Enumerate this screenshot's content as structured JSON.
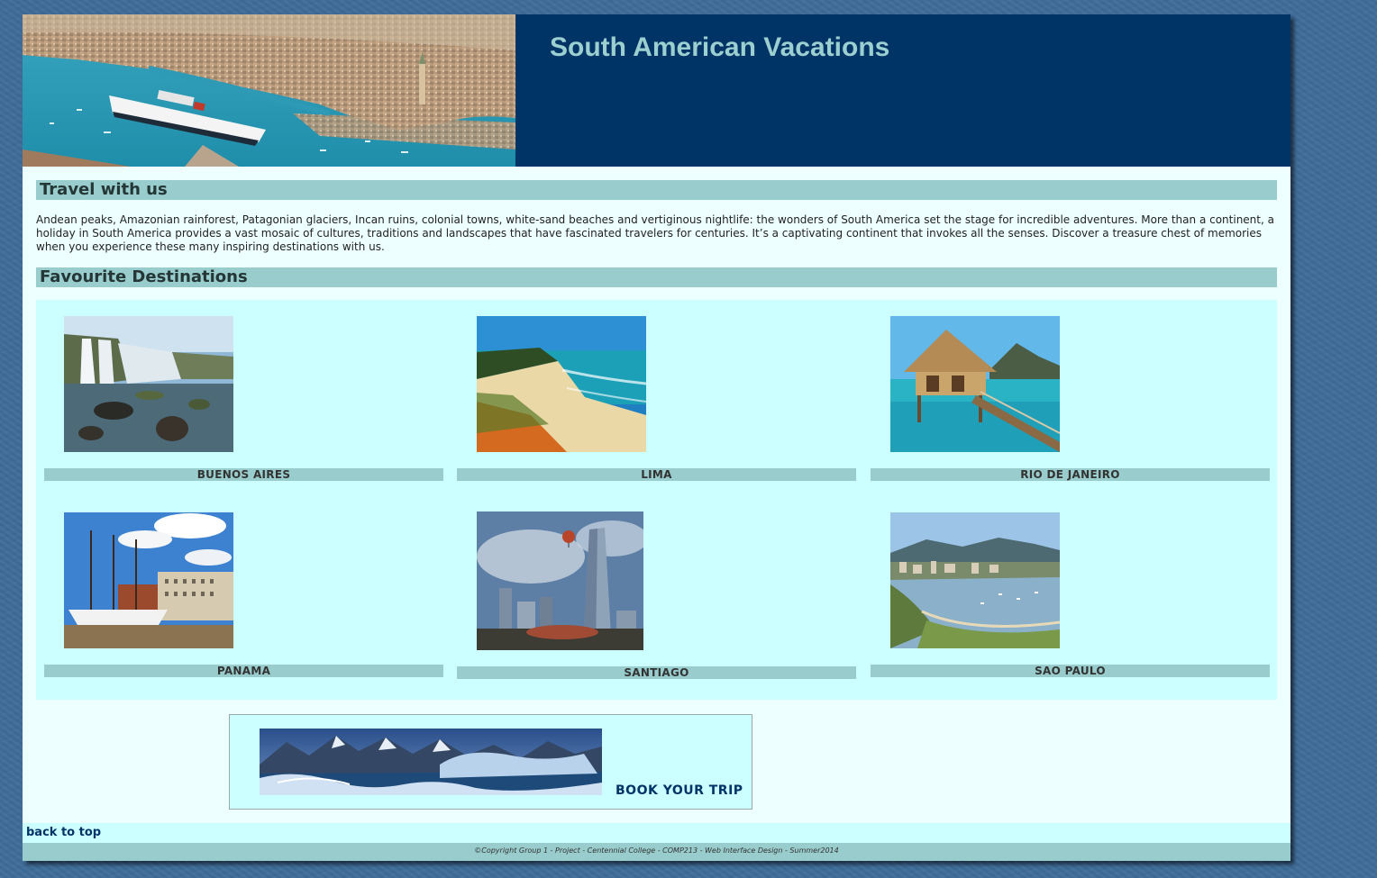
{
  "header": {
    "title": "South American Vacations"
  },
  "intro": {
    "heading": "Travel with us",
    "body": "Andean peaks, Amazonian rainforest, Patagonian glaciers, Incan ruins, colonial towns, white-sand beaches and vertiginous nightlife: the wonders of South America set the stage for incredible adventures. More than a continent, a holiday in South America provides a vast mosaic of cultures, traditions and landscapes that have fascinated travelers for centuries. It’s a captivating continent that invokes all the senses. Discover a treasure chest of memories when you experience these many inspiring destinations with us."
  },
  "destinations": {
    "heading": "Favourite Destinations",
    "items": [
      {
        "label": "BUENOS AIRES"
      },
      {
        "label": "LIMA"
      },
      {
        "label": "RIO DE JANEIRO"
      },
      {
        "label": "PANAMA"
      },
      {
        "label": "SANTIAGO"
      },
      {
        "label": "SAO PAULO"
      }
    ]
  },
  "booking": {
    "link_label": "BOOK YOUR TRIP"
  },
  "nav": {
    "back_to_top": "back to top"
  },
  "footer": {
    "copyright": "©Copyright Group 1 - Project - Centennial College - COMP213 - Web Interface Design - Summer2014"
  },
  "colors": {
    "body_background": "#3e6c99",
    "header_background": "#003366",
    "title_color": "#9cd0d0",
    "heading_bar": "#99cccc",
    "panel_background": "#ccffff",
    "page_background": "#edfffe",
    "link_color": "#003366"
  }
}
